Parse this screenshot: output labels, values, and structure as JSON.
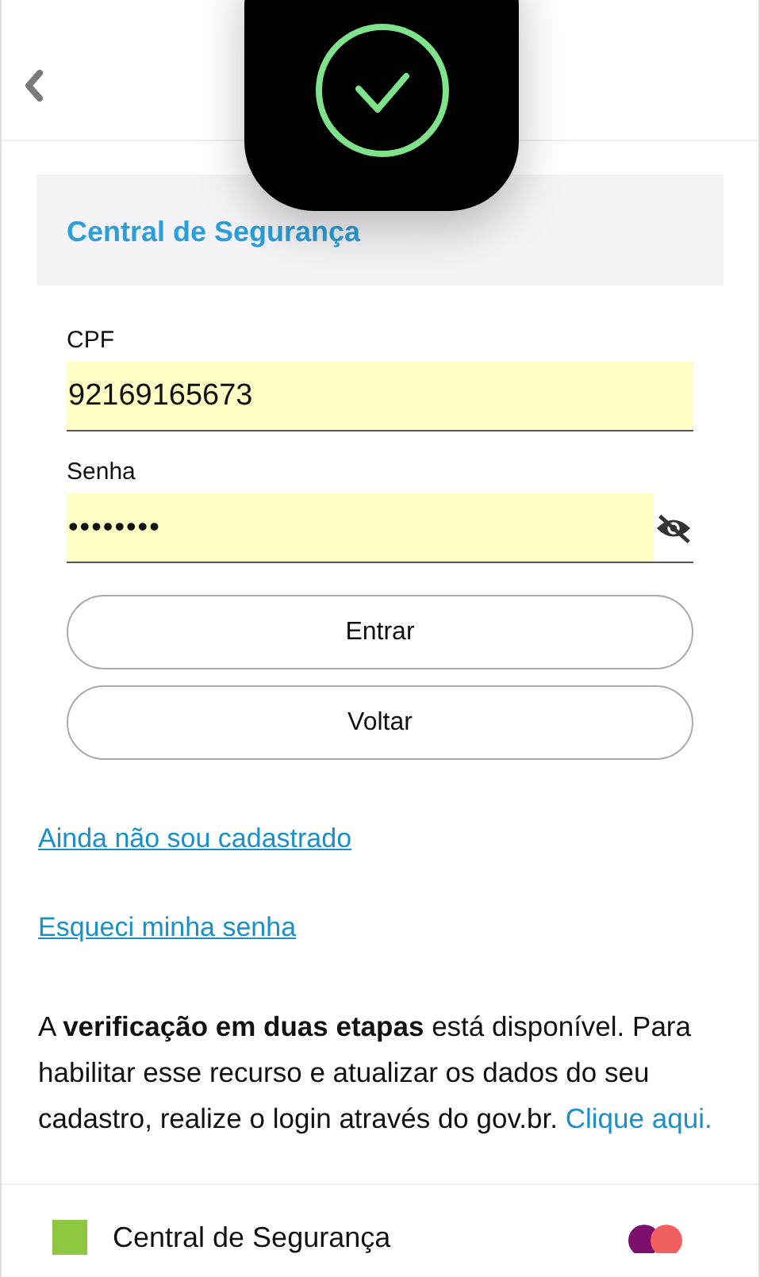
{
  "overlay": {
    "kind": "success"
  },
  "card": {
    "title": "Central de Segurança"
  },
  "fields": [
    {
      "label": "CPF",
      "value": "92169165673",
      "kind": "text"
    },
    {
      "label": "Senha",
      "value": "••••••••",
      "kind": "password",
      "revealed": false
    }
  ],
  "buttons": [
    "Entrar",
    "Voltar"
  ],
  "links": [
    "Ainda não sou cadastrado",
    "Esqueci minha senha"
  ],
  "notice": {
    "text": "A **verificação em duas etapas** está disponível. Para habilitar esse recurso e atualizar os dados do seu cadastro, realize o login através do gov.br.",
    "link": "Clique aqui."
  },
  "footer": {
    "title": "Central de Segurança"
  }
}
